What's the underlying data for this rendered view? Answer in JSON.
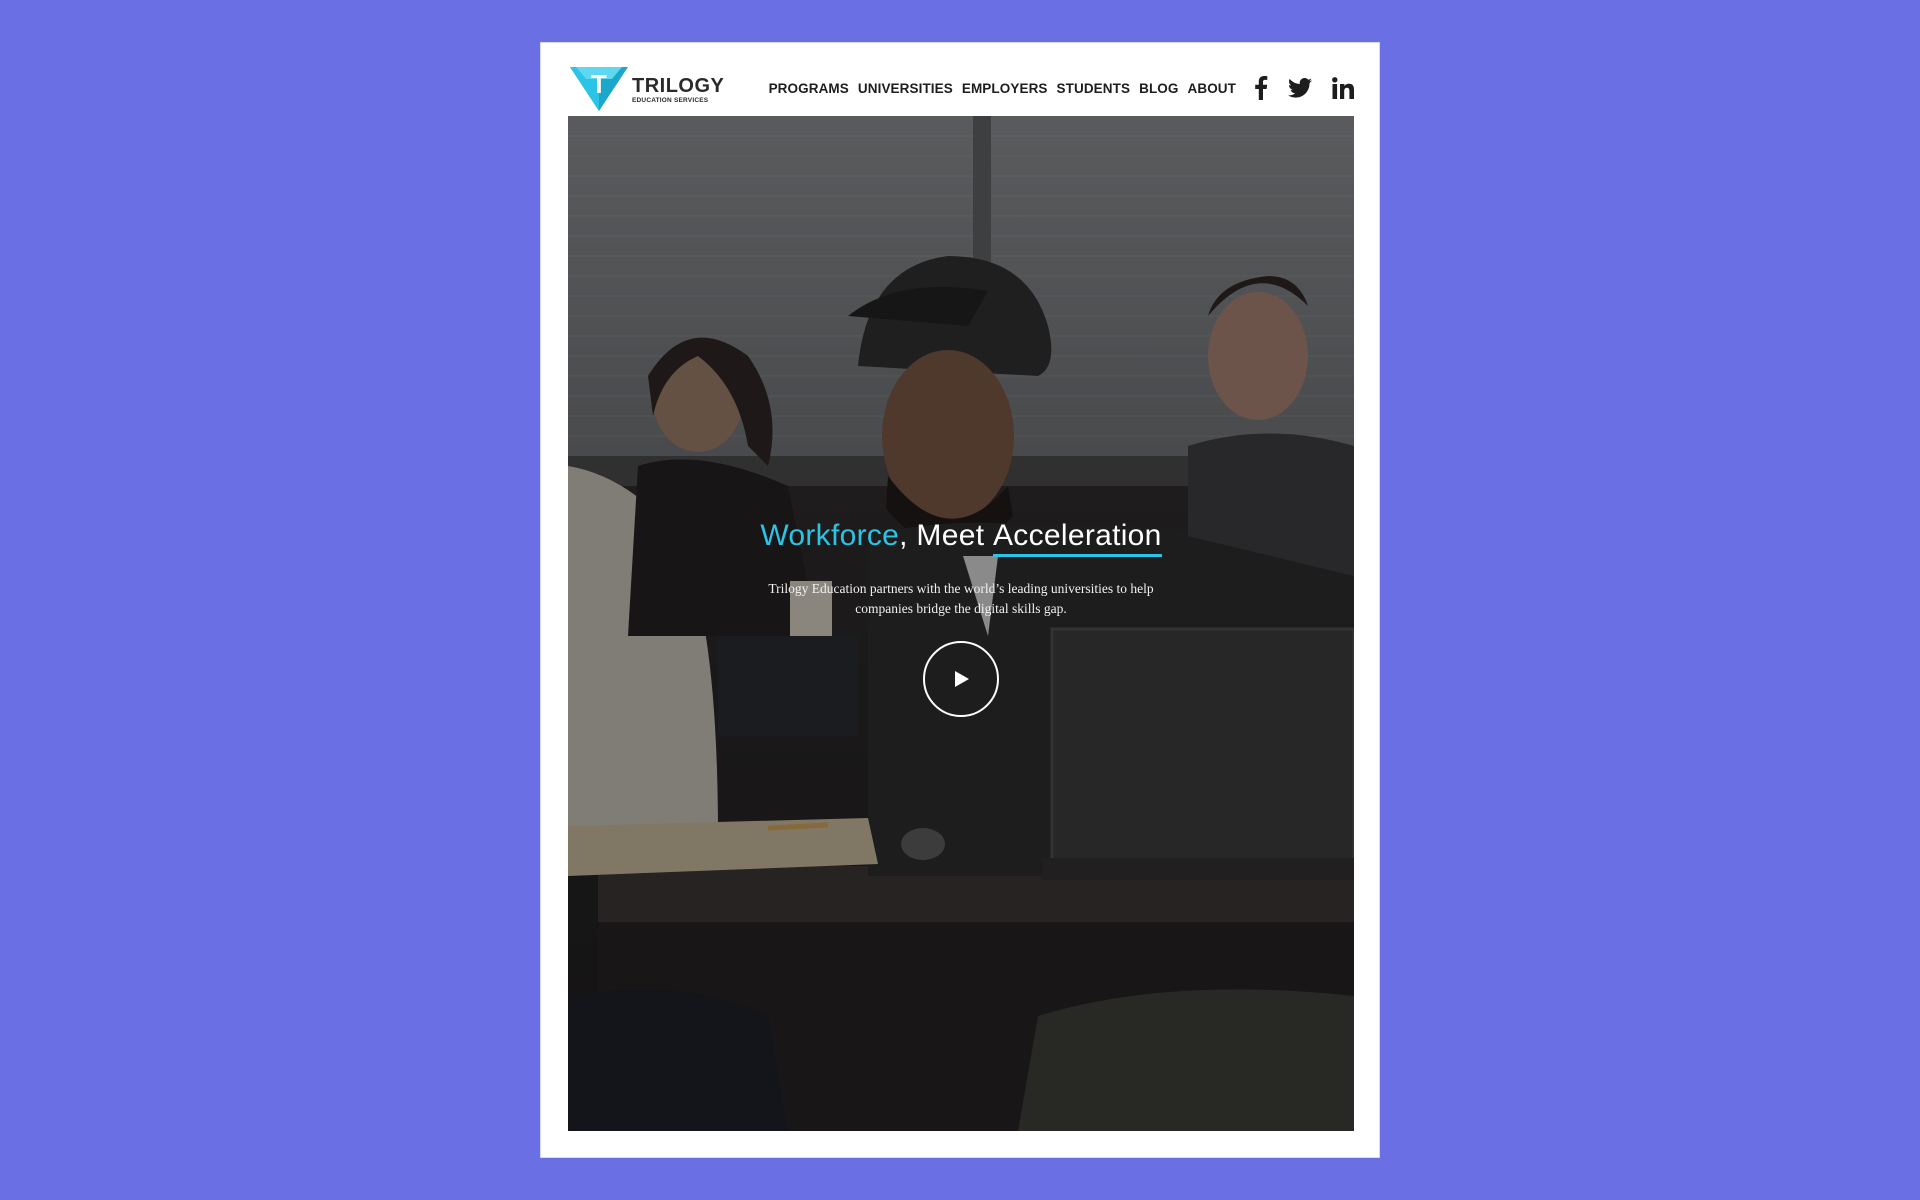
{
  "brand": {
    "name": "TRILOGY",
    "tagline": "EDUCATION SERVICES",
    "logo_letter": "T",
    "colors": {
      "accent": "#2bc3e6",
      "logo_dark": "#1aa7c9",
      "page_background": "#6a6fe3"
    }
  },
  "nav": {
    "items": [
      {
        "label": "PROGRAMS"
      },
      {
        "label": "UNIVERSITIES"
      },
      {
        "label": "EMPLOYERS"
      },
      {
        "label": "STUDENTS"
      },
      {
        "label": "BLOG"
      },
      {
        "label": "ABOUT"
      }
    ],
    "social": [
      {
        "icon": "facebook-icon"
      },
      {
        "icon": "twitter-icon"
      },
      {
        "icon": "linkedin-icon"
      }
    ]
  },
  "hero": {
    "headline_part1": "Workforce",
    "headline_comma": ",",
    "headline_part2": " Meet ",
    "headline_part3": "Acceleration",
    "subtext": "Trilogy Education partners with the world’s leading universities to help companies bridge the digital skills gap.",
    "play_icon": "play-icon"
  }
}
